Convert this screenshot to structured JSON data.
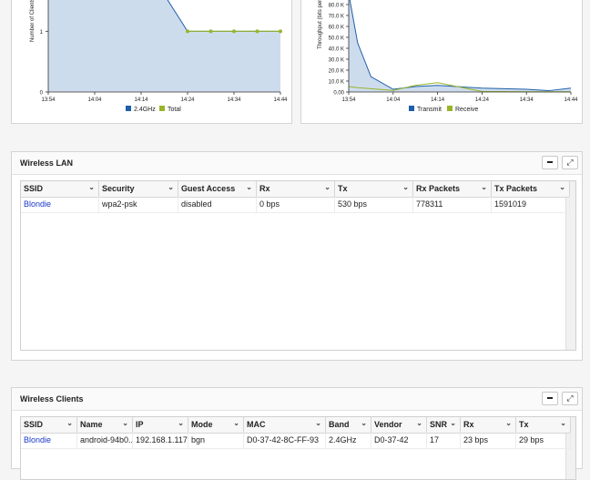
{
  "colors": {
    "series_blue": "#1f5fa8",
    "series_green": "#97b52a",
    "area_fill": "#cddced",
    "link": "#1a38c8"
  },
  "clients_chart": {
    "ylabel": "Number of Clients",
    "y_ticks": [
      "1",
      "0"
    ],
    "x_ticks": [
      "13:54",
      "14:04",
      "14:14",
      "14:24",
      "14:34",
      "14:44"
    ],
    "legend": [
      {
        "label": "2.4GHz",
        "color": "#1f5fa8"
      },
      {
        "label": "Total",
        "color": "#97b52a"
      }
    ]
  },
  "throughput_chart": {
    "ylabel": "Throughput (bits per s...",
    "y_ticks": [
      "80.0 K",
      "70.0 K",
      "60.0 K",
      "50.0 K",
      "40.0 K",
      "30.0 K",
      "20.0 K",
      "10.0 K",
      "0.00"
    ],
    "x_ticks": [
      "13:54",
      "14:04",
      "14:14",
      "14:24",
      "14:34",
      "14:44"
    ],
    "legend": [
      {
        "label": "Transmit",
        "color": "#1f5fa8"
      },
      {
        "label": "Receive",
        "color": "#97b52a"
      }
    ]
  },
  "chart_data": [
    {
      "type": "area",
      "ylabel": "Number of Clients",
      "x": [
        "13:54",
        "14:04",
        "14:14",
        "14:19",
        "14:24",
        "14:29",
        "14:34",
        "14:39",
        "14:44"
      ],
      "ylim": [
        0,
        1.5
      ],
      "series": [
        {
          "name": "2.4GHz",
          "values": [
            1.6,
            1.6,
            1.6,
            1.6,
            1,
            1,
            1,
            1,
            1
          ]
        },
        {
          "name": "Total",
          "values": [
            null,
            null,
            null,
            null,
            1,
            1,
            1,
            1,
            1
          ]
        }
      ]
    },
    {
      "type": "line",
      "ylabel": "Throughput (bits per s...",
      "x": [
        "13:54",
        "13:56",
        "13:59",
        "14:04",
        "14:09",
        "14:14",
        "14:24",
        "14:34",
        "14:39",
        "14:44"
      ],
      "ylim": [
        0,
        85000
      ],
      "series": [
        {
          "name": "Transmit",
          "values": [
            90000,
            45000,
            14000,
            2500,
            5000,
            6000,
            3500,
            2500,
            1200,
            3500
          ]
        },
        {
          "name": "Receive",
          "values": [
            5000,
            4000,
            3000,
            1500,
            6000,
            8500,
            500,
            200,
            200,
            200
          ]
        }
      ]
    }
  ],
  "wlan": {
    "title": "Wireless LAN",
    "minimize_label": "–",
    "expand_label": "⤢",
    "columns": [
      "SSID",
      "Security",
      "Guest Access",
      "Rx",
      "Tx",
      "Rx Packets",
      "Tx Packets"
    ],
    "rows": [
      [
        "Blondie",
        "wpa2-psk",
        "disabled",
        "0 bps",
        "530 bps",
        "778311",
        "1591019"
      ]
    ]
  },
  "clients": {
    "title": "Wireless Clients",
    "minimize_label": "–",
    "expand_label": "⤢",
    "columns": [
      "SSID",
      "Name",
      "IP",
      "Mode",
      "MAC",
      "Band",
      "Vendor",
      "SNR",
      "Rx",
      "Tx"
    ],
    "rows": [
      [
        "Blondie",
        "android-94b0...",
        "192.168.1.117",
        "bgn",
        "D0-37-42-8C-FF-93",
        "2.4GHz",
        "D0-37-42",
        "17",
        "23 bps",
        "29 bps"
      ]
    ]
  }
}
